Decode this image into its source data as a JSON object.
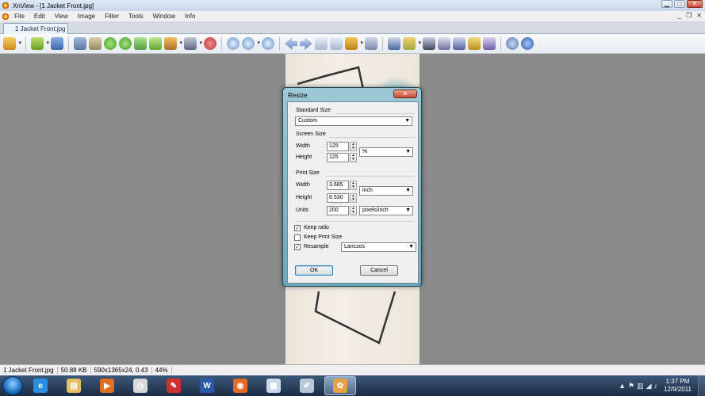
{
  "window": {
    "title": "XnView - [1 Jacket Front.jpg]",
    "controls": {
      "minimize": "▁",
      "maximize": "□",
      "close": "✕"
    }
  },
  "menu": {
    "items": [
      "File",
      "Edit",
      "View",
      "Image",
      "Filter",
      "Tools",
      "Window",
      "Info"
    ],
    "controls": {
      "minimize": "_",
      "restore": "❐",
      "close": "✕"
    }
  },
  "tab": {
    "label": "1 Jacket Front.jpg"
  },
  "toolbar": {
    "icons": [
      "browser-icon",
      "open-folder-icon",
      "save-icon",
      "undo-icon",
      "crop-icon",
      "rotate-left-icon",
      "rotate-right-icon",
      "copy-icon",
      "paste-icon",
      "adjust-icon",
      "effects-icon",
      "filter-icon",
      "zoom-in-icon",
      "zoom-icon",
      "zoom-out-icon",
      "previous-icon",
      "next-icon",
      "first-icon",
      "last-icon",
      "slideshow-icon",
      "fullscreen-icon",
      "fit-icon",
      "export-icon",
      "find-icon",
      "print-icon",
      "scan-icon",
      "wallpaper-icon",
      "capture-icon",
      "settings-icon",
      "info-icon"
    ]
  },
  "status": {
    "filename": "1 Jacket Front.jpg",
    "filesize": "50.88 KB",
    "dimensions": "590x1365x24, 0.43",
    "zoom": "44%"
  },
  "taskbar": {
    "apps": [
      {
        "name": "internet-explorer-icon",
        "glyph": "e",
        "color": "#2a8fe0"
      },
      {
        "name": "file-explorer-icon",
        "glyph": "▤",
        "color": "#e8c060"
      },
      {
        "name": "media-player-icon",
        "glyph": "▶",
        "color": "#e07020"
      },
      {
        "name": "clock-app-icon",
        "glyph": "◷",
        "color": "#d8d8d8"
      },
      {
        "name": "pin-app-icon",
        "glyph": "✎",
        "color": "#d03030"
      },
      {
        "name": "word-icon",
        "glyph": "W",
        "color": "#2a5aa8"
      },
      {
        "name": "firefox-icon",
        "glyph": "◉",
        "color": "#e86a20"
      },
      {
        "name": "document-app-icon",
        "glyph": "▦",
        "color": "#c8d8e8"
      },
      {
        "name": "paint-icon",
        "glyph": "✐",
        "color": "#b8c8d8"
      },
      {
        "name": "xnview-icon",
        "glyph": "✿",
        "color": "#e8a040"
      }
    ],
    "active_index": 9,
    "tray_icons": [
      "▲",
      "⚑",
      "▥",
      "◢",
      "♪"
    ],
    "time": "1:37 PM",
    "date": "12/9/2011"
  },
  "dialog": {
    "title": "Resize",
    "close": "✕",
    "standard_size_label": "Standard Size",
    "standard_size_value": "Custom",
    "screen_size_label": "Screen Size",
    "screen_width_label": "Width",
    "screen_width_value": "125",
    "screen_height_label": "Height",
    "screen_height_value": "125",
    "screen_unit": "%",
    "print_size_label": "Print Size",
    "print_width_label": "Width",
    "print_width_value": "3.685",
    "print_height_label": "Height",
    "print_height_value": "8.530",
    "print_unit": "inch",
    "units_label": "Units",
    "units_value": "200",
    "units_unit": "pixels/inch",
    "keep_ratio_label": "Keep ratio",
    "keep_ratio_checked": true,
    "keep_print_size_label": "Keep Print Size",
    "keep_print_size_checked": false,
    "resample_label": "Resample",
    "resample_checked": true,
    "resample_method": "Lanczos",
    "ok_label": "OK",
    "cancel_label": "Cancel"
  }
}
